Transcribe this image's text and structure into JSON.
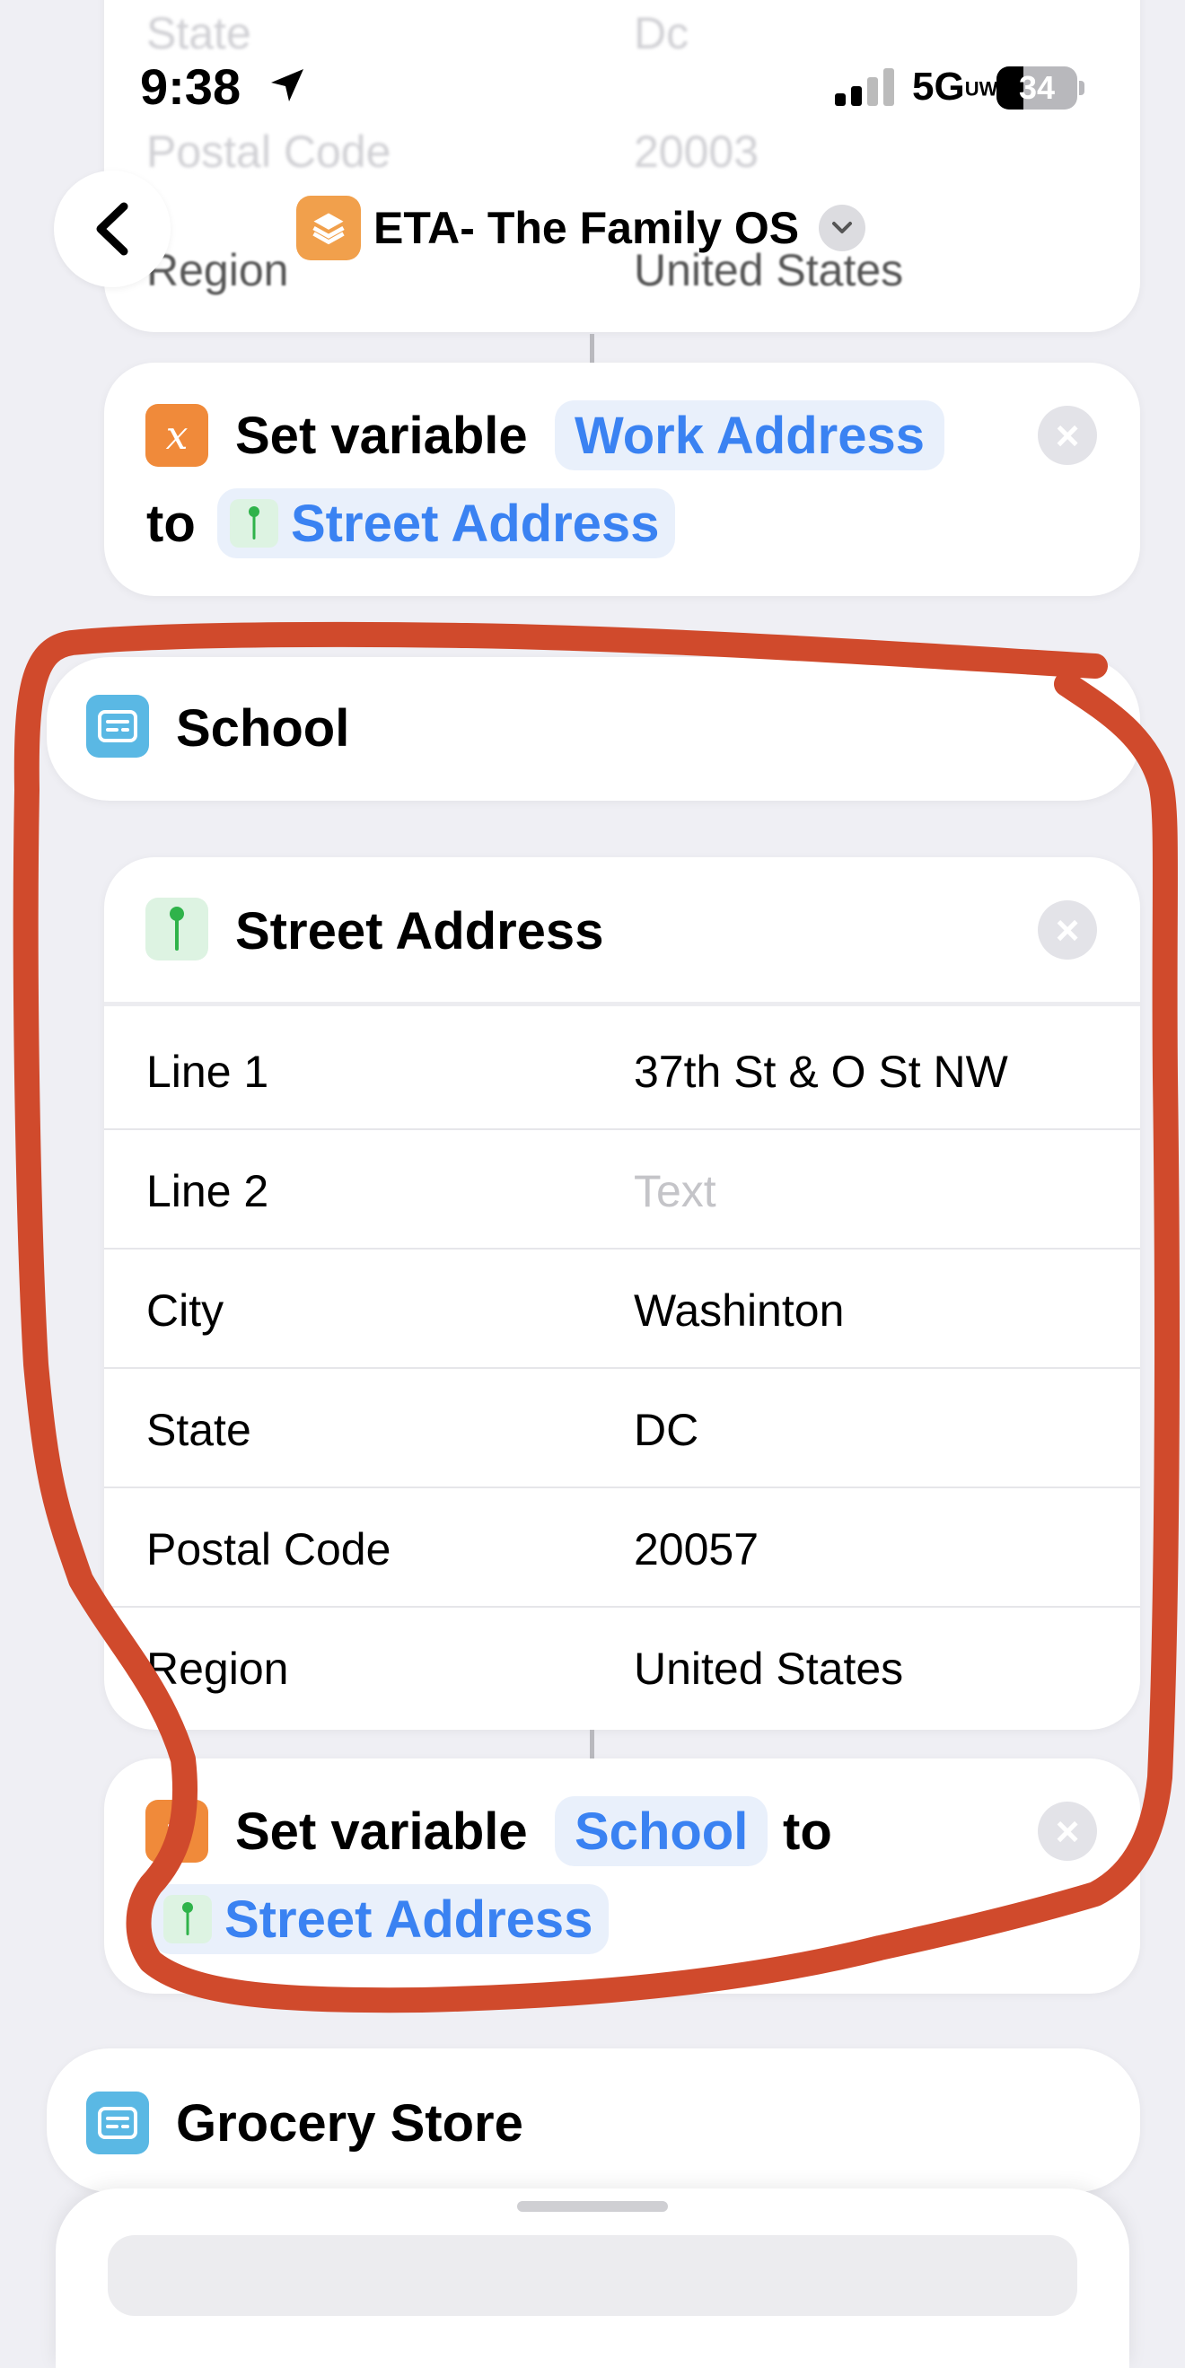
{
  "status_bar": {
    "time": "9:38",
    "network": "5G",
    "network_suffix": "UW",
    "battery": "34"
  },
  "nav": {
    "title": "ETA- The Family OS"
  },
  "prev_address_rows": [
    {
      "label": "State",
      "value": "Dc"
    },
    {
      "label": "Postal Code",
      "value": "20003"
    },
    {
      "label": "Region",
      "value": "United States"
    }
  ],
  "set_work": {
    "prefix": "Set variable",
    "variable": "Work Address",
    "to": "to",
    "value": "Street Address"
  },
  "school_text": {
    "label": "School"
  },
  "street_address": {
    "title": "Street Address",
    "rows": [
      {
        "label": "Line 1",
        "value": "37th St & O St NW",
        "placeholder": false
      },
      {
        "label": "Line 2",
        "value": "Text",
        "placeholder": true
      },
      {
        "label": "City",
        "value": "Washinton",
        "placeholder": false
      },
      {
        "label": "State",
        "value": "DC",
        "placeholder": false
      },
      {
        "label": "Postal Code",
        "value": "20057",
        "placeholder": false
      },
      {
        "label": "Region",
        "value": "United States",
        "placeholder": false
      }
    ]
  },
  "set_school": {
    "prefix": "Set variable",
    "variable": "School",
    "to": "to",
    "value": "Street Address"
  },
  "grocery_text": {
    "label": "Grocery Store"
  },
  "colors": {
    "accent": "#3a82f2",
    "variable_icon": "#f08a3a",
    "text_icon": "#5ab8e4",
    "annotation": "#d04a2c"
  }
}
